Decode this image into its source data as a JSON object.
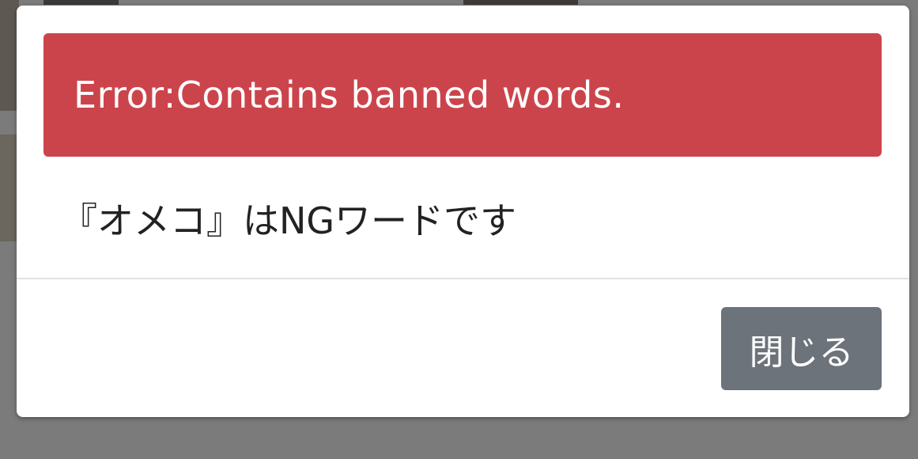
{
  "alert": {
    "text": "Error:Contains banned words."
  },
  "message": {
    "text": "『オメコ』はNGワードです"
  },
  "footer": {
    "close_label": "閉じる"
  },
  "colors": {
    "alert_bg": "#cc444b",
    "button_bg": "#6d737a",
    "backdrop": "#7b7b7b"
  }
}
